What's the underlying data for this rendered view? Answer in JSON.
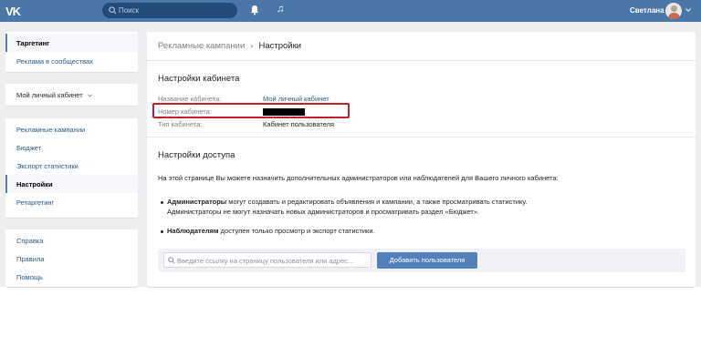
{
  "topbar": {
    "logo": "VK",
    "search_placeholder": "Поиск",
    "user_name": "Светлана"
  },
  "sidebar": {
    "group1": [
      {
        "label": "Таргетинг",
        "active": true
      },
      {
        "label": "Реклама в сообществах",
        "active": false
      }
    ],
    "cabinet_selector": "Мой личный кабинет",
    "group3": [
      {
        "label": "Рекламные кампании",
        "active": false
      },
      {
        "label": "Бюджет",
        "active": false
      },
      {
        "label": "Экспорт статистики",
        "active": false
      },
      {
        "label": "Настройки",
        "active": true
      },
      {
        "label": "Ретаргетинг",
        "active": false
      }
    ],
    "group4": [
      {
        "label": "Справка"
      },
      {
        "label": "Правила"
      },
      {
        "label": "Помощь"
      }
    ]
  },
  "main": {
    "breadcrumb": {
      "parent": "Рекламные кампании",
      "separator": "›",
      "current": "Настройки"
    },
    "cabinet_settings": {
      "title": "Настройки кабинета",
      "rows": [
        {
          "label": "Название кабинета:",
          "value": "Мой личный кабинет"
        },
        {
          "label": "Номер кабинета:",
          "value": ""
        },
        {
          "label": "Тип кабинета:",
          "value": "Кабинет пользователя"
        }
      ]
    },
    "access_settings": {
      "title": "Настройки доступа",
      "intro": "На этой странице Вы можете назначить дополнительных администраторов или наблюдателей для Вашего личного кабинета:",
      "bullets": [
        {
          "bold": "Администраторы",
          "text1": " могут создавать и редактировать объявления и кампании, а также просматривать статистику.",
          "text2": "Администраторы не могут назначать новых администраторов и просматривать раздел «Бюджет»."
        },
        {
          "bold": "Наблюдателям",
          "text1": " доступен только просмотр и экспорт статистики."
        }
      ],
      "input_placeholder": "Введите ссылку на страницу пользователя или адрес...",
      "add_button": "Добавить пользователя"
    }
  },
  "colors": {
    "header": "#4a76a8",
    "link": "#2a5885",
    "button": "#5181b8",
    "highlight": "#c8202b"
  }
}
